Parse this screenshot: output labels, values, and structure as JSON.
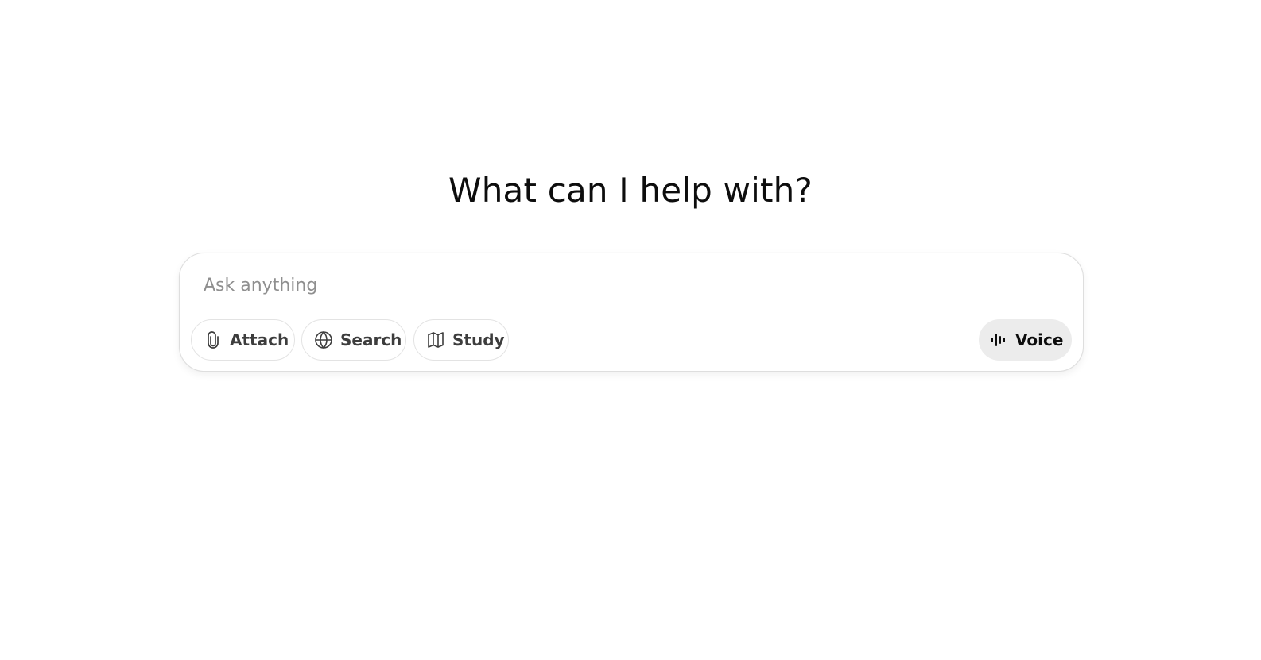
{
  "main": {
    "headline": "What can I help with?"
  },
  "composer": {
    "placeholder": "Ask anything",
    "value": "",
    "tools": [
      {
        "label": "Attach",
        "icon": "paperclip-icon"
      },
      {
        "label": "Search",
        "icon": "globe-icon"
      },
      {
        "label": "Study",
        "icon": "book-icon"
      }
    ],
    "voice": {
      "label": "Voice",
      "icon": "voice-waveform-icon"
    }
  },
  "colors": {
    "background": "#ffffff",
    "text": "#0d0d0d",
    "placeholder": "#8f8f8f",
    "pill_text": "#3d3d3d",
    "pill_border": "#e3e3e3",
    "voice_bg": "#ececec"
  }
}
